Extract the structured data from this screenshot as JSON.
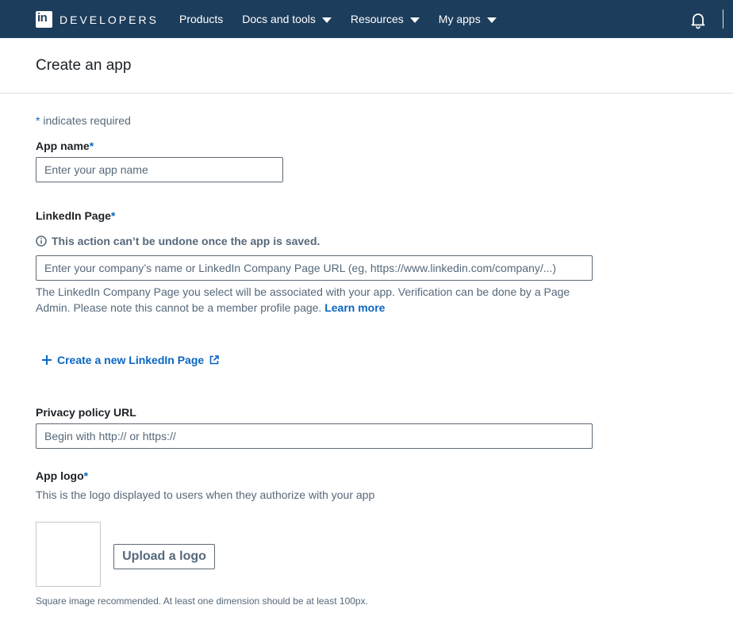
{
  "nav": {
    "brand_word": "DEVELOPERS",
    "items": [
      {
        "label": "Products",
        "has_dropdown": false
      },
      {
        "label": "Docs and tools",
        "has_dropdown": true
      },
      {
        "label": "Resources",
        "has_dropdown": true
      },
      {
        "label": "My apps",
        "has_dropdown": true
      }
    ],
    "bell_icon": "bell-icon"
  },
  "page": {
    "title": "Create an app"
  },
  "form": {
    "required_note": {
      "star": "*",
      "text": "indicates required"
    },
    "app_name": {
      "label": "App name",
      "star": "*",
      "placeholder": "Enter your app name",
      "value": ""
    },
    "linkedin_page": {
      "label": "LinkedIn Page",
      "star": "*",
      "warning": "This action can’t be undone once the app is saved.",
      "placeholder": "Enter your company’s name or LinkedIn Company Page URL (eg, https://www.linkedin.com/company/...)",
      "value": "",
      "help_text": "The LinkedIn Company Page you select will be associated with your app. Verification can be done by a Page Admin. Please note this cannot be a member profile page.",
      "learn_more": "Learn more"
    },
    "create_page_link": "Create a new LinkedIn Page",
    "privacy_policy": {
      "label": "Privacy policy URL",
      "placeholder": "Begin with http:// or https://",
      "value": ""
    },
    "app_logo": {
      "label": "App logo",
      "star": "*",
      "description": "This is the logo displayed to users when they authorize with your app",
      "upload_button": "Upload a logo",
      "hint": "Square image recommended. At least one dimension should be at least 100px."
    }
  },
  "colors": {
    "topbar": "#1d3d5c",
    "accent": "#0a66c2",
    "muted_text": "#56687a"
  }
}
